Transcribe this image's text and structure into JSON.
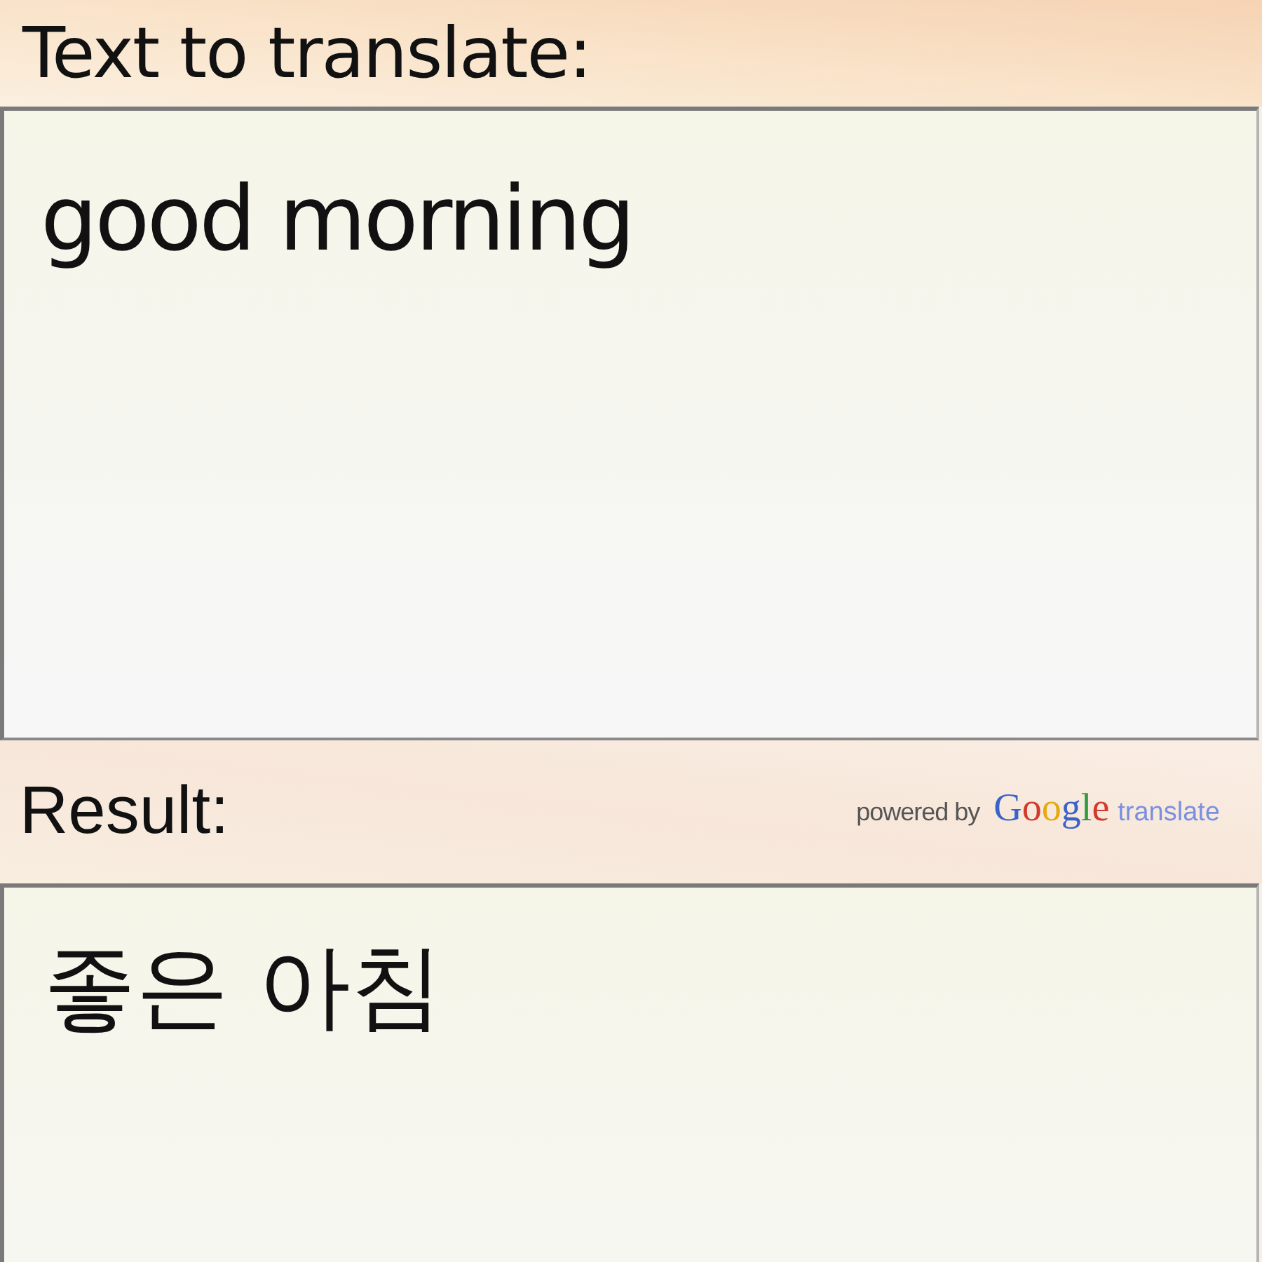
{
  "source": {
    "label": "Text to translate:",
    "value": "good morning"
  },
  "result": {
    "label": "Result:",
    "attribution": {
      "prefix": "powered by",
      "brand": "Google",
      "product": "translate"
    },
    "value": "좋은 아침"
  }
}
